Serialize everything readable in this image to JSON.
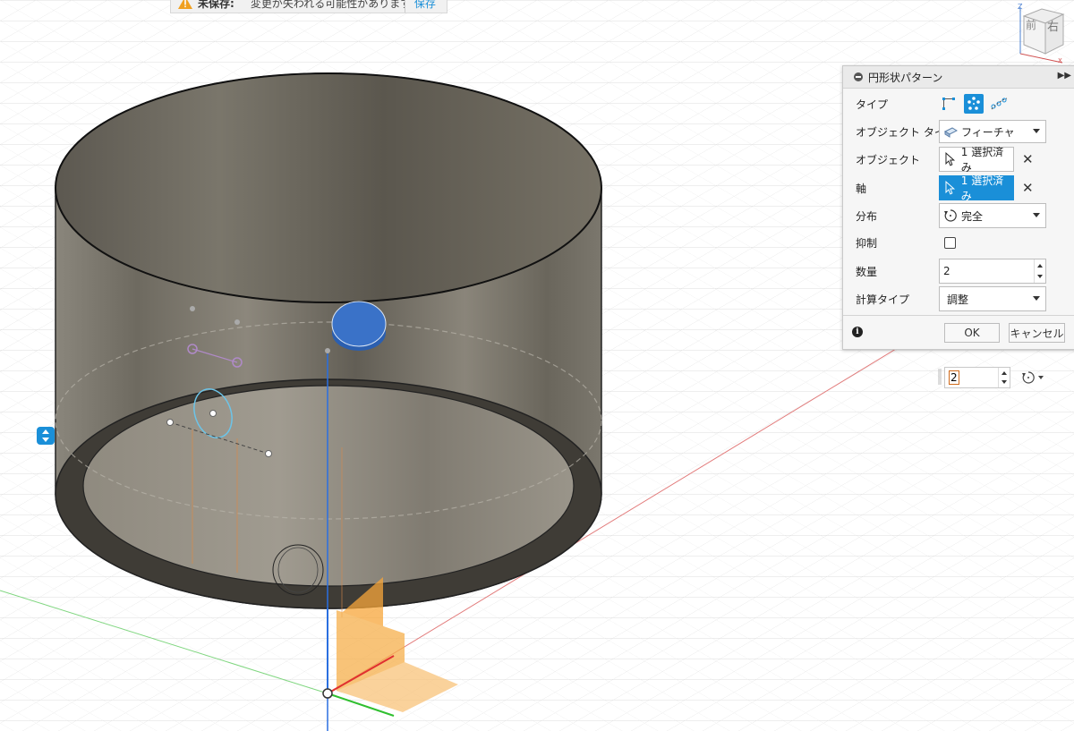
{
  "banner": {
    "unsaved_label": "未保存:",
    "message": "変更が失われる可能性があります",
    "save_label": "保存"
  },
  "viewcube": {
    "front_label": "前",
    "right_label": "右",
    "axis_z": "Z",
    "axis_x": "X"
  },
  "dialog": {
    "title": "円形状パターン",
    "rows": {
      "type_label": "タイプ",
      "object_type_label": "オブジェクト タイプ",
      "object_type_value": "フィーチャ",
      "objects_label": "オブジェクト",
      "objects_value": "1 選択済み",
      "axis_label": "軸",
      "axis_value": "1 選択済み",
      "distribution_label": "分布",
      "distribution_value": "完全",
      "suppress_label": "抑制",
      "quantity_label": "数量",
      "quantity_value": "2",
      "compute_type_label": "計算タイプ",
      "compute_type_value": "調整"
    },
    "ok_label": "OK",
    "cancel_label": "キャンセル"
  },
  "floating_input": {
    "value": "2"
  },
  "colors": {
    "accent": "#1a8fd8",
    "model_body": "#7d786d",
    "selection_blue": "#3a72c8",
    "plane_orange": "#f7a63a",
    "x_axis": "#e03030",
    "y_axis": "#2fbf2f",
    "z_axis": "#2a6fe0"
  }
}
